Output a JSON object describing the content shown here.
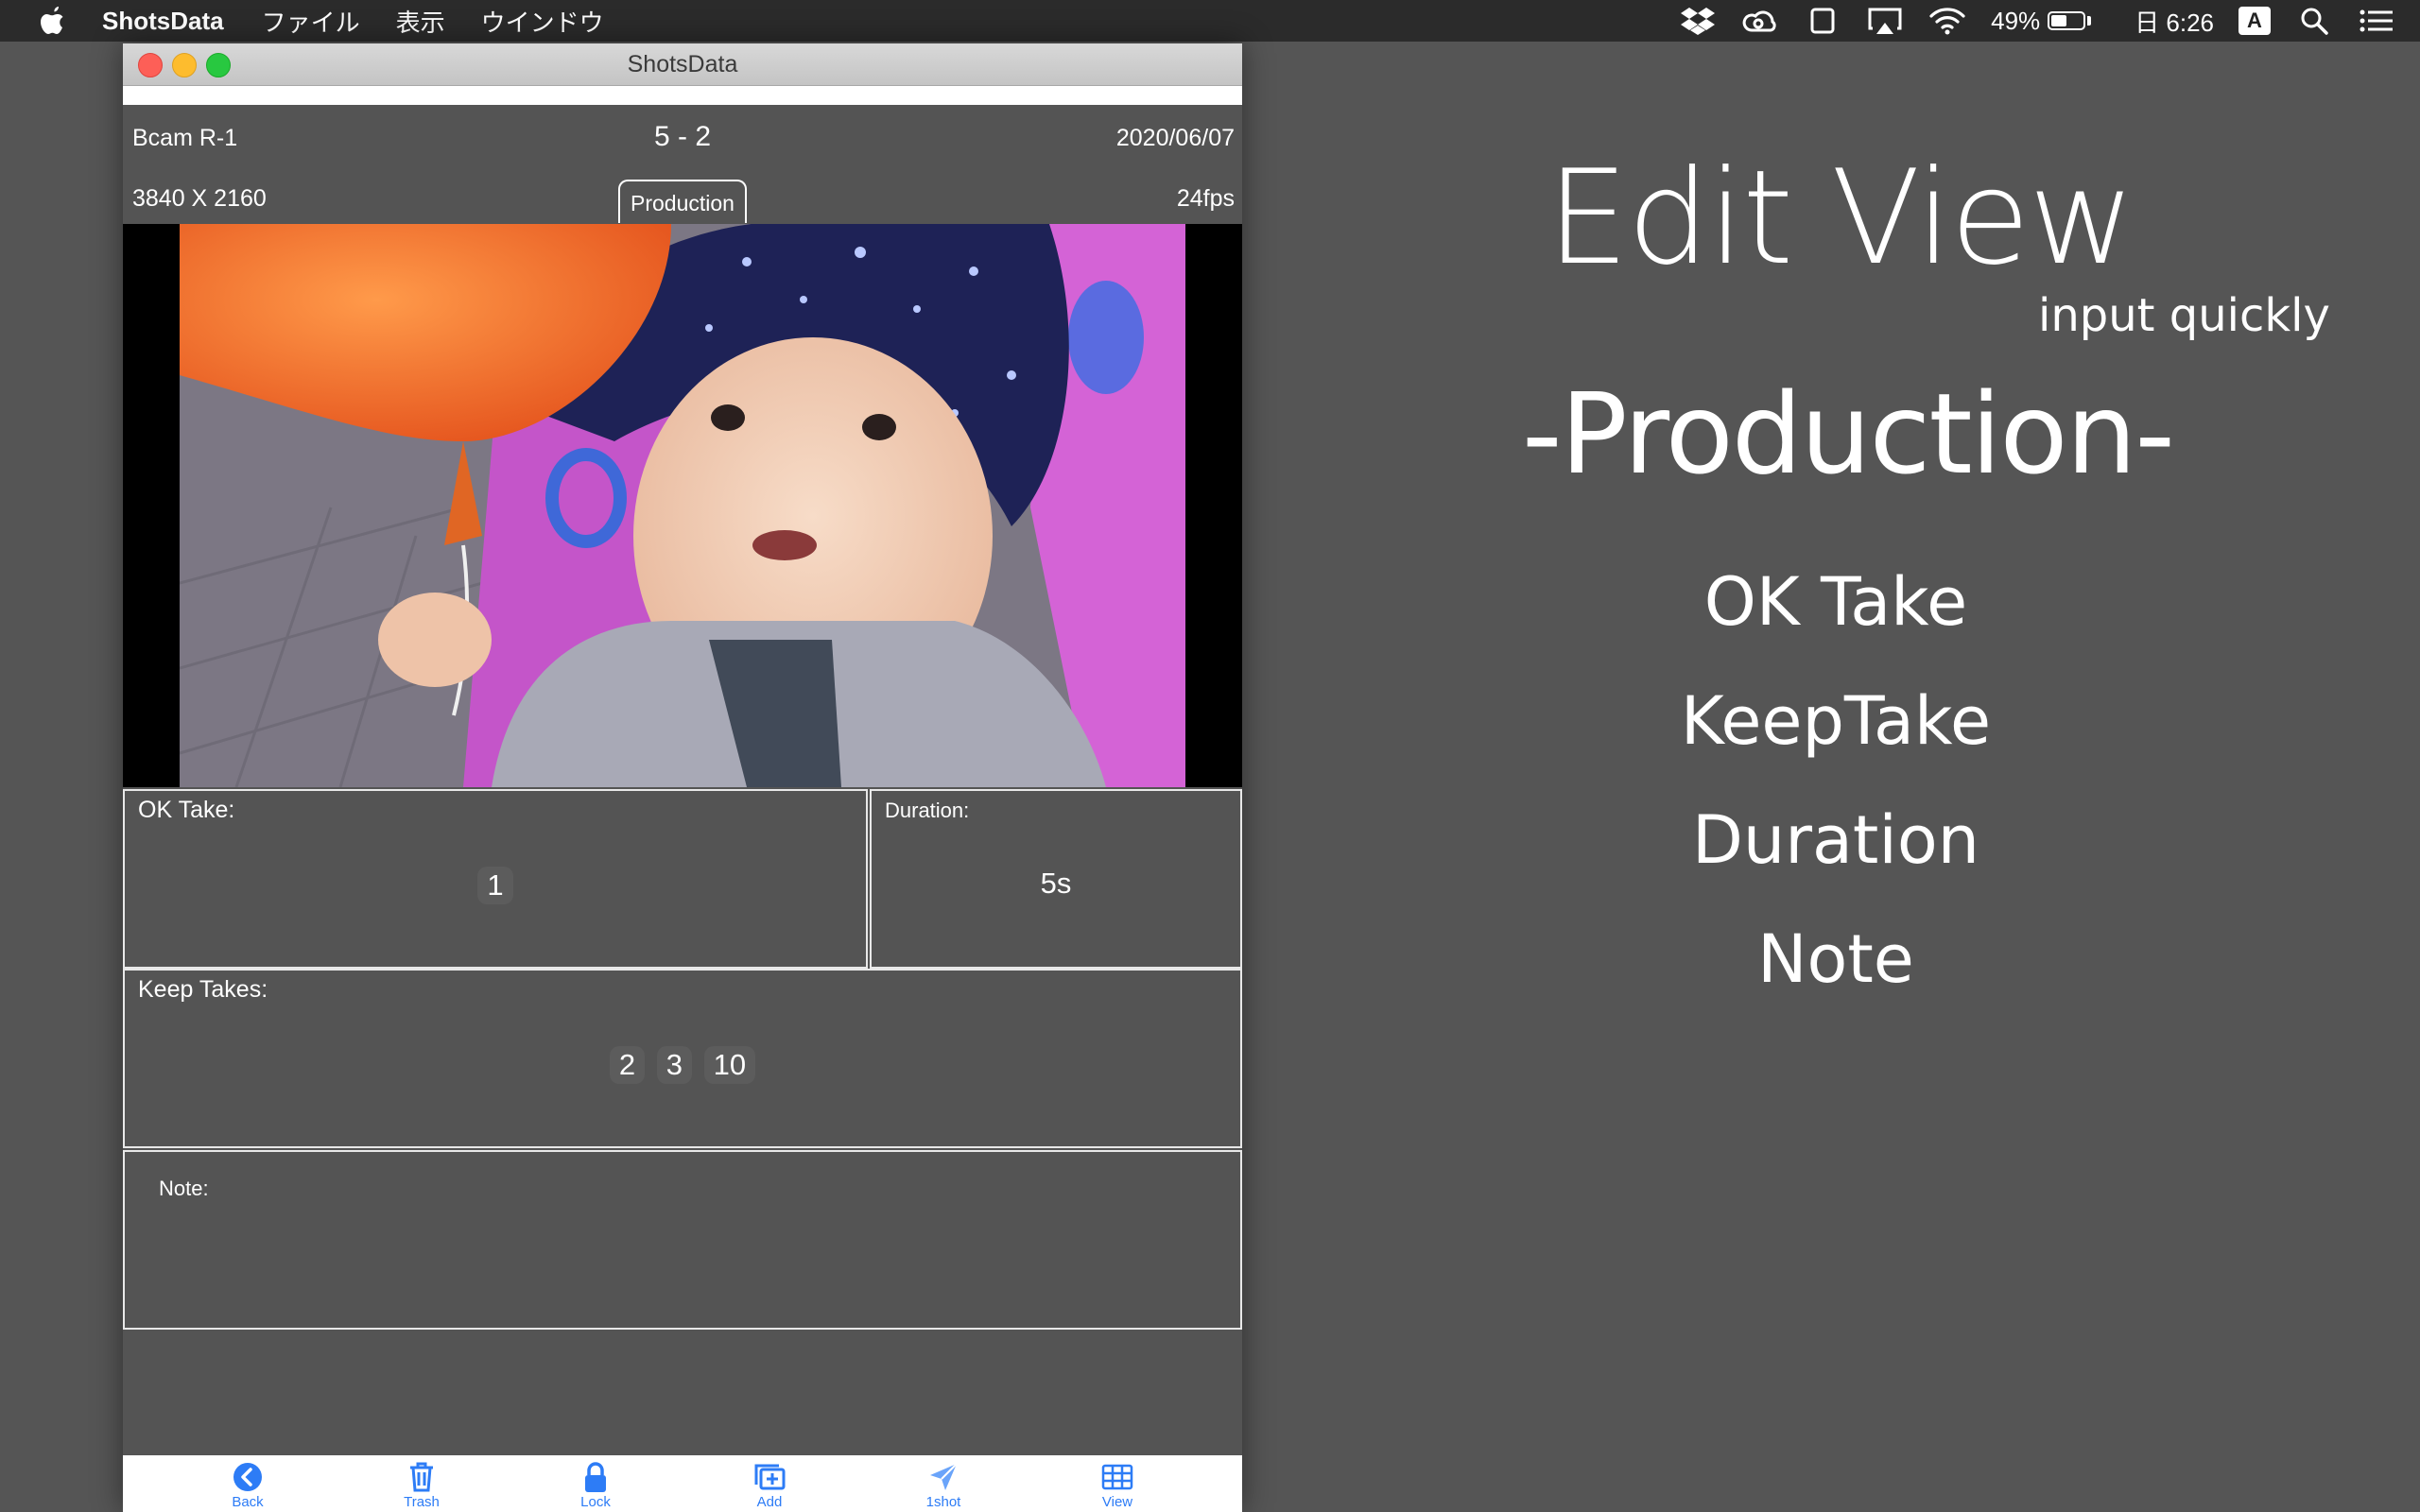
{
  "menubar": {
    "app_name": "ShotsData",
    "menus": [
      "ファイル",
      "表示",
      "ウインドウ"
    ],
    "battery_percent": "49%",
    "battery_level": 0.49,
    "clock": "日 6:26",
    "ime": "A",
    "tray_icons": [
      "dropbox-icon",
      "creative-cloud-icon",
      "screen-icon",
      "airplay-icon",
      "wifi-icon"
    ]
  },
  "window": {
    "title": "ShotsData",
    "camera": "Bcam R-1",
    "scene_take": "5 - 2",
    "date": "2020/06/07",
    "resolution": "3840 X 2160",
    "mode_tab": "Production",
    "fps": "24fps",
    "ok_take": {
      "label": "OK Take:",
      "value": "1"
    },
    "duration": {
      "label": "Duration:",
      "value": "5s"
    },
    "keep_takes": {
      "label": "Keep Takes:",
      "values": [
        "2",
        "3",
        "10"
      ]
    },
    "note": {
      "label": "Note:",
      "value": ""
    },
    "toolbar": [
      {
        "label": "Back",
        "icon": "back-icon"
      },
      {
        "label": "Trash",
        "icon": "trash-icon"
      },
      {
        "label": "Lock",
        "icon": "lock-icon"
      },
      {
        "label": "Add",
        "icon": "add-icon"
      },
      {
        "label": "1shot",
        "icon": "send-icon"
      },
      {
        "label": "View",
        "icon": "grid-icon"
      }
    ],
    "accent_color": "#2d7cf6"
  },
  "promo": {
    "headline": "Edit View",
    "tagline": "input quickly",
    "mode": "-Production-",
    "features": [
      "OK Take",
      "KeepTake",
      "Duration",
      "Note"
    ]
  }
}
